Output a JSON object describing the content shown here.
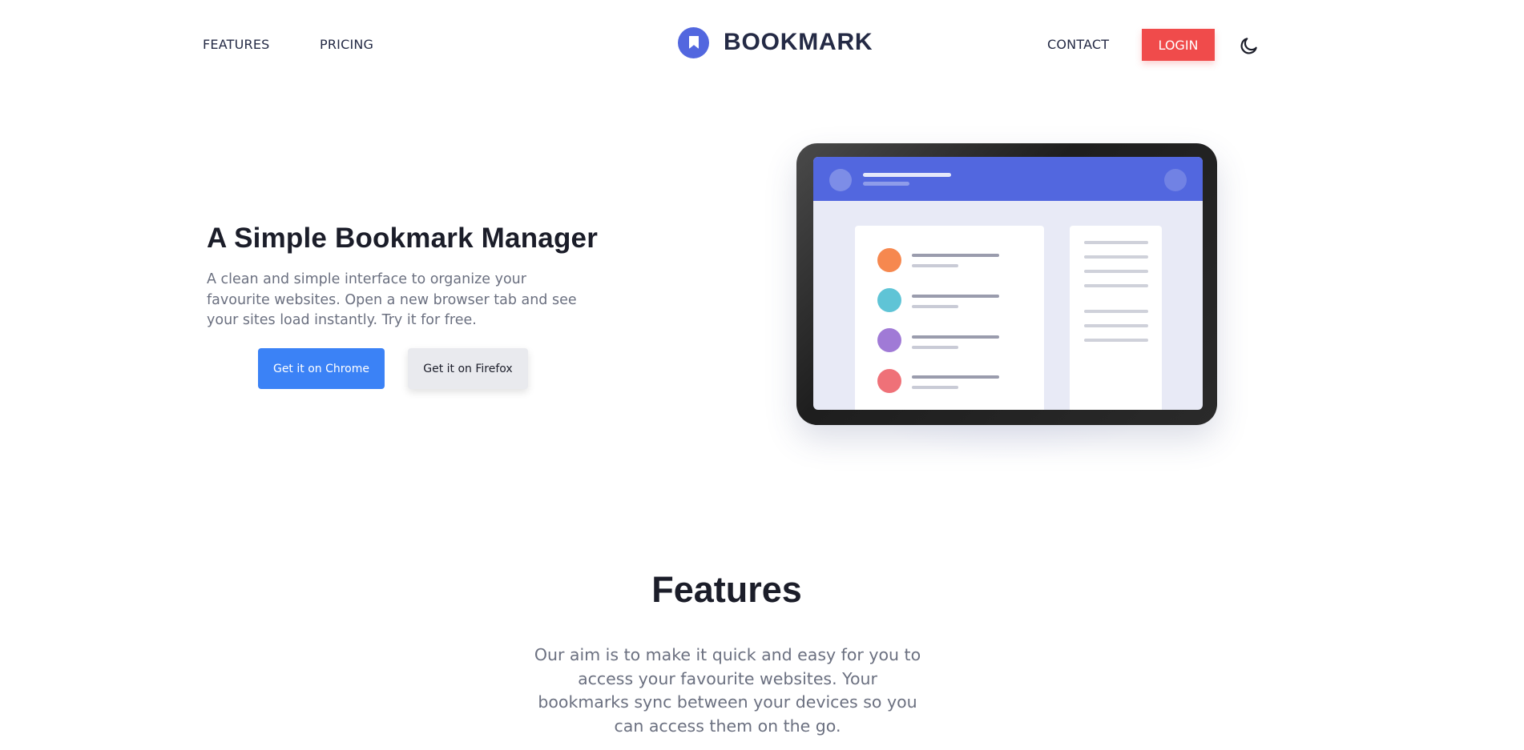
{
  "nav": {
    "features_label": "FEATURES",
    "pricing_label": "PRICING",
    "logo_text": "BOOKMARK",
    "contact_label": "CONTACT",
    "login_label": "LOGIN",
    "theme_toggle_icon": "moon-icon",
    "logo_icon": "bookmark-icon"
  },
  "hero": {
    "title": "A Simple Bookmark Manager",
    "description": "A clean and simple interface to organize your favourite websites. Open a new browser tab and see your sites load instantly. Try it for free.",
    "chrome_button": "Get it on Chrome",
    "firefox_button": "Get it on Firefox"
  },
  "illustration": {
    "row_dot_colors": [
      "#f6884f",
      "#5fc4d6",
      "#a07ad6",
      "#ef7178"
    ]
  },
  "features": {
    "title": "Features",
    "description": "Our aim is to make it quick and easy for you to access your favourite websites. Your bookmarks sync between your devices so you can access them on the go."
  },
  "colors": {
    "brand": "#5267df",
    "login": "#f04b4b",
    "chrome": "#3b82f6",
    "text_dark": "#242a45",
    "text_muted": "#6b7080"
  }
}
